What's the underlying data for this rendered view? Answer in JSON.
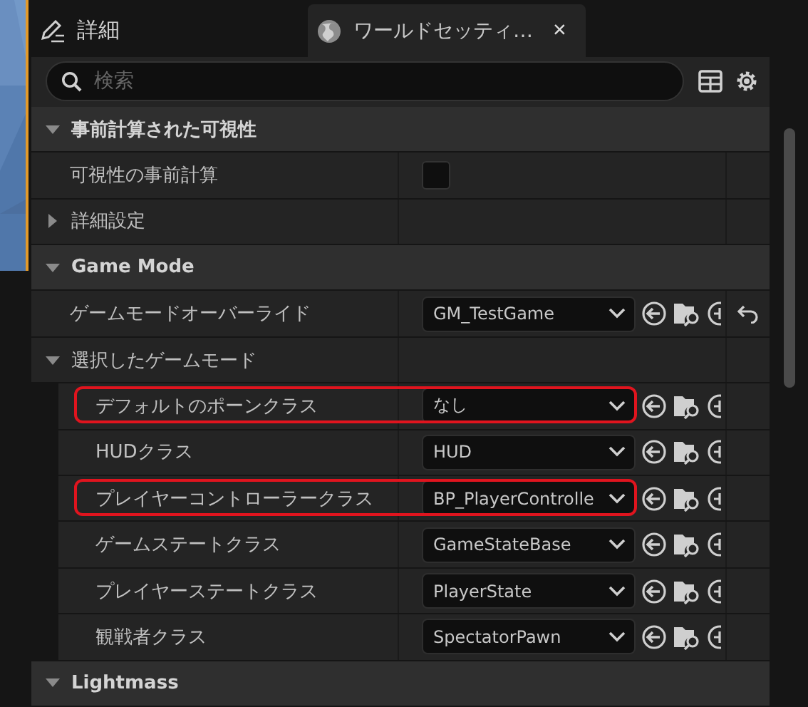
{
  "header": {
    "title": "詳細"
  },
  "tab": {
    "label": "ワールドセッティ…",
    "selected": true,
    "close": "×"
  },
  "search": {
    "placeholder": "検索"
  },
  "sections": [
    {
      "kind": "category",
      "label": "事前計算された可視性",
      "expanded": true
    },
    {
      "kind": "checkbox",
      "label": "可視性の事前計算",
      "checked": false
    },
    {
      "kind": "group",
      "label": "詳細設定",
      "expanded": false
    },
    {
      "kind": "category",
      "label": "Game Mode",
      "expanded": true
    },
    {
      "kind": "dropdown",
      "label": "ゲームモードオーバーライド",
      "value": "GM_TestGame",
      "resettable": true
    },
    {
      "kind": "group",
      "label": "選択したゲームモード",
      "expanded": true,
      "children": [
        {
          "label": "デフォルトのポーンクラス",
          "value": "なし",
          "highlighted": true
        },
        {
          "label": "HUDクラス",
          "value": "HUD",
          "highlighted": false
        },
        {
          "label": "プレイヤーコントローラークラス",
          "value": "BP_PlayerControlle",
          "highlighted": true
        },
        {
          "label": "ゲームステートクラス",
          "value": "GameStateBase",
          "highlighted": false
        },
        {
          "label": "プレイヤーステートクラス",
          "value": "PlayerState",
          "highlighted": false
        },
        {
          "label": "観戦者クラス",
          "value": "SpectatorPawn",
          "highlighted": false
        }
      ]
    },
    {
      "kind": "category",
      "label": "Lightmass",
      "expanded": true
    }
  ]
}
